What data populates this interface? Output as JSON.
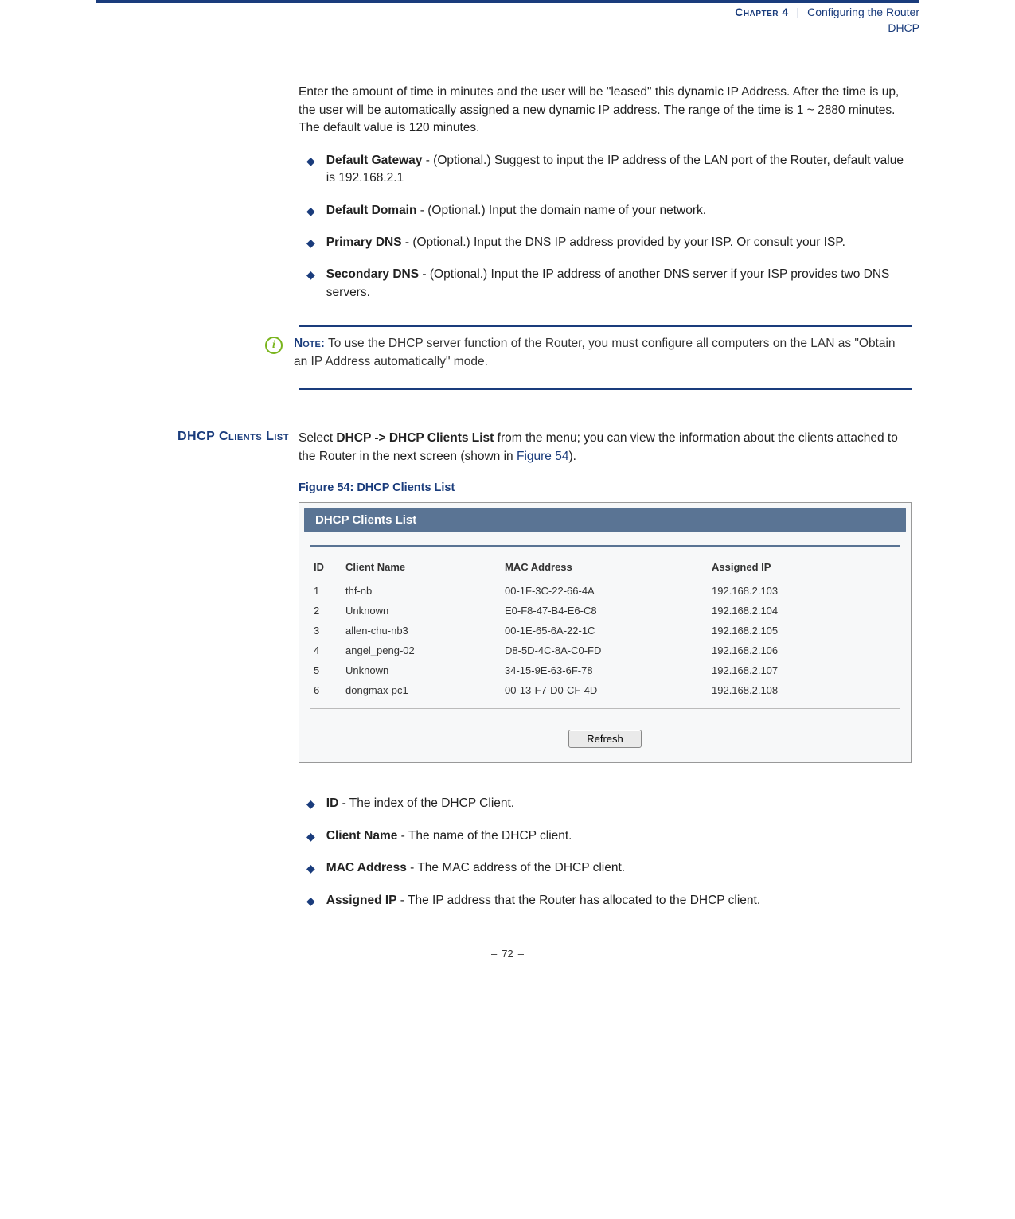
{
  "header": {
    "chapter_label": "Chapter 4",
    "separator": "|",
    "chapter_title": "Configuring the Router",
    "section": "DHCP"
  },
  "intro_para": "Enter the amount of time in minutes and the user will be \"leased\" this dynamic IP Address. After the time is up, the user will be automatically assigned a new dynamic IP address. The range of the time is 1 ~ 2880 minutes. The default value is 120 minutes.",
  "bullets_top": [
    {
      "term": "Default Gateway",
      "desc": " - (Optional.) Suggest to input the IP address of the LAN port of the Router, default value is 192.168.2.1"
    },
    {
      "term": "Default Domain",
      "desc": " - (Optional.) Input the domain name of your network."
    },
    {
      "term": "Primary DNS",
      "desc": " - (Optional.) Input the DNS IP address provided by your ISP. Or consult your ISP."
    },
    {
      "term": "Secondary DNS",
      "desc": " - (Optional.) Input the IP address of another DNS server if your ISP provides two DNS servers."
    }
  ],
  "note": {
    "label": "Note:",
    "text": " To use the DHCP server function of the Router, you must configure all computers on the LAN as \"Obtain an IP Address automatically\" mode."
  },
  "section_heading": "DHCP Clients List",
  "section_para_pre": "Select ",
  "section_para_bold": "DHCP -> DHCP Clients List",
  "section_para_post": " from the menu; you can view the information about the clients attached to the Router in the next screen (shown in ",
  "section_para_figref": "Figure 54",
  "section_para_end": ").",
  "figure_caption": "Figure 54:  DHCP Clients List",
  "screenshot": {
    "title": "DHCP Clients List",
    "headers": {
      "id": "ID",
      "name": "Client Name",
      "mac": "MAC Address",
      "ip": "Assigned IP"
    },
    "rows": [
      {
        "id": "1",
        "name": "thf-nb",
        "mac": "00-1F-3C-22-66-4A",
        "ip": "192.168.2.103"
      },
      {
        "id": "2",
        "name": "Unknown",
        "mac": "E0-F8-47-B4-E6-C8",
        "ip": "192.168.2.104"
      },
      {
        "id": "3",
        "name": "allen-chu-nb3",
        "mac": "00-1E-65-6A-22-1C",
        "ip": "192.168.2.105"
      },
      {
        "id": "4",
        "name": "angel_peng-02",
        "mac": "D8-5D-4C-8A-C0-FD",
        "ip": "192.168.2.106"
      },
      {
        "id": "5",
        "name": "Unknown",
        "mac": "34-15-9E-63-6F-78",
        "ip": "192.168.2.107"
      },
      {
        "id": "6",
        "name": "dongmax-pc1",
        "mac": "00-13-F7-D0-CF-4D",
        "ip": "192.168.2.108"
      }
    ],
    "refresh_label": "Refresh"
  },
  "bullets_bottom": [
    {
      "term": "ID",
      "desc": " - The index of the DHCP Client."
    },
    {
      "term": "Client Name",
      "desc": " - The name of the DHCP client."
    },
    {
      "term": "MAC Address",
      "desc": " - The MAC address of the DHCP client."
    },
    {
      "term": "Assigned IP",
      "desc": " - The IP address that the Router has allocated to the DHCP client."
    }
  ],
  "footer": {
    "page": "72"
  }
}
